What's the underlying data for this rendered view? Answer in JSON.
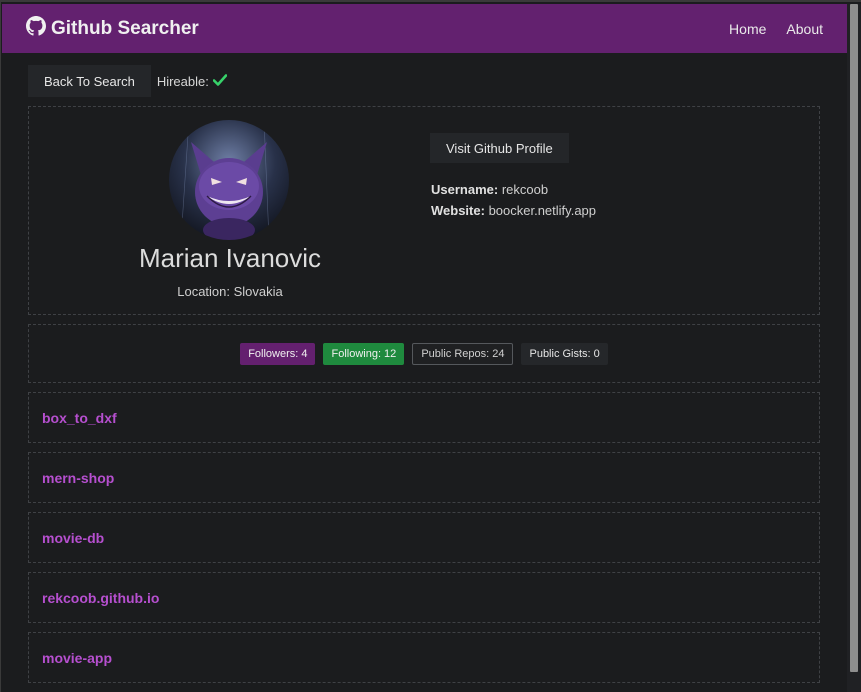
{
  "navbar": {
    "brand": "Github Searcher",
    "links": [
      "Home",
      "About"
    ]
  },
  "actions": {
    "back_label": "Back To Search",
    "hireable_label": "Hireable:"
  },
  "profile": {
    "name": "Marian Ivanovic",
    "location": "Location: Slovakia",
    "visit_label": "Visit Github Profile",
    "username_label": "Username:",
    "username": "rekcoob",
    "website_label": "Website:",
    "website": "boocker.netlify.app"
  },
  "stats": {
    "followers": "Followers: 4",
    "following": "Following: 12",
    "repos": "Public Repos: 24",
    "gists": "Public Gists: 0"
  },
  "repos": [
    "box_to_dxf",
    "mern-shop",
    "movie-db",
    "rekcoob.github.io",
    "movie-app"
  ],
  "colors": {
    "navbar": "#63216f",
    "accent": "#b64fcf",
    "success": "#1f8a3e",
    "check": "#37d26a"
  }
}
